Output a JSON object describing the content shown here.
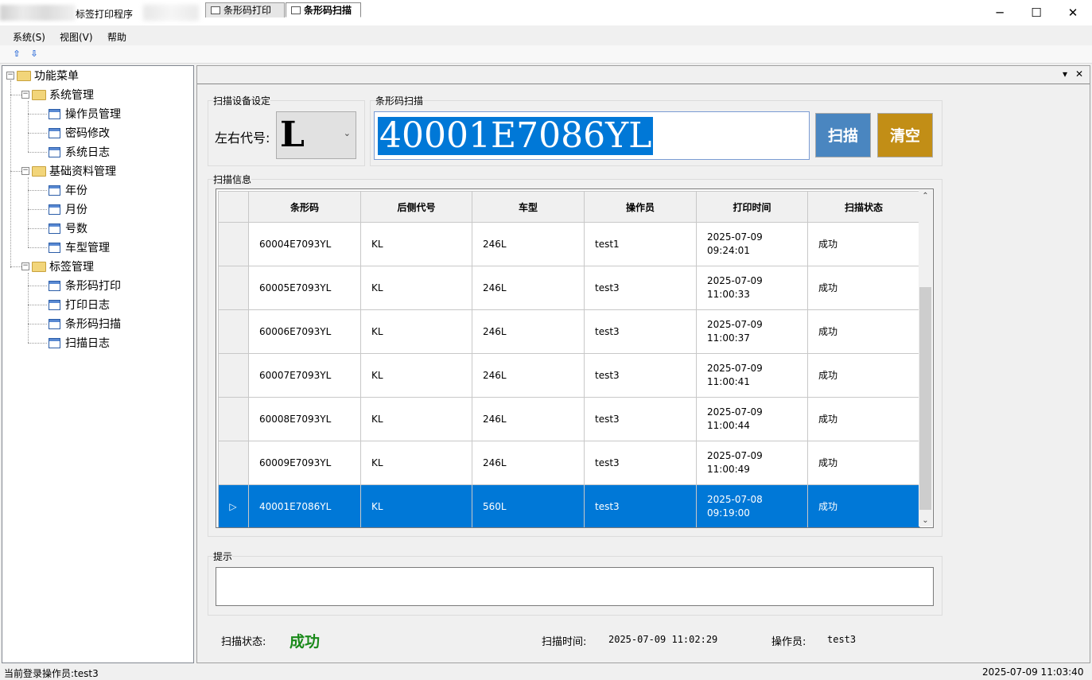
{
  "window": {
    "title": "标签打印程序",
    "minimize": "─",
    "maximize": "☐",
    "close": "✕"
  },
  "menu": [
    "系统(S)",
    "视图(V)",
    "帮助"
  ],
  "toolbar": {
    "up": "⇧",
    "down": "⇩"
  },
  "tree": {
    "root": "功能菜单",
    "groups": [
      {
        "label": "系统管理",
        "items": [
          "操作员管理",
          "密码修改",
          "系统日志"
        ]
      },
      {
        "label": "基础资料管理",
        "items": [
          "年份",
          "月份",
          "号数",
          "车型管理"
        ]
      },
      {
        "label": "标签管理",
        "items": [
          "条形码打印",
          "打印日志",
          "条形码扫描",
          "扫描日志"
        ]
      }
    ]
  },
  "tabs": [
    {
      "label": "条形码打印",
      "active": false
    },
    {
      "label": "条形码扫描",
      "active": true
    }
  ],
  "tab_controls": {
    "dropdown": "▾",
    "close": "✕"
  },
  "device_group": {
    "label": "扫描设备设定",
    "field_label": "左右代号:",
    "combo_value": "L",
    "combo_arrow": "⌄"
  },
  "scan_group": {
    "label": "条形码扫描",
    "input_value": "40001E7086YL",
    "scan_button": "扫描",
    "clear_button": "清空"
  },
  "info_group": {
    "label": "扫描信息",
    "columns": [
      "条形码",
      "后侧代号",
      "车型",
      "操作员",
      "打印时间",
      "扫描状态"
    ],
    "rows": [
      {
        "barcode": "60004E7093YL",
        "code": "KL",
        "model": "246L",
        "operator": "test1",
        "date": "2025-07-09",
        "time": "09:24:01",
        "status": "成功",
        "selected": false
      },
      {
        "barcode": "60005E7093YL",
        "code": "KL",
        "model": "246L",
        "operator": "test3",
        "date": "2025-07-09",
        "time": "11:00:33",
        "status": "成功",
        "selected": false
      },
      {
        "barcode": "60006E7093YL",
        "code": "KL",
        "model": "246L",
        "operator": "test3",
        "date": "2025-07-09",
        "time": "11:00:37",
        "status": "成功",
        "selected": false
      },
      {
        "barcode": "60007E7093YL",
        "code": "KL",
        "model": "246L",
        "operator": "test3",
        "date": "2025-07-09",
        "time": "11:00:41",
        "status": "成功",
        "selected": false
      },
      {
        "barcode": "60008E7093YL",
        "code": "KL",
        "model": "246L",
        "operator": "test3",
        "date": "2025-07-09",
        "time": "11:00:44",
        "status": "成功",
        "selected": false
      },
      {
        "barcode": "60009E7093YL",
        "code": "KL",
        "model": "246L",
        "operator": "test3",
        "date": "2025-07-09",
        "time": "11:00:49",
        "status": "成功",
        "selected": false
      },
      {
        "barcode": "40001E7086YL",
        "code": "KL",
        "model": "560L",
        "operator": "test3",
        "date": "2025-07-08",
        "time": "09:19:00",
        "status": "成功",
        "selected": true
      }
    ],
    "selected_marker": "▷",
    "scroll_up": "⌃",
    "scroll_down": "⌄"
  },
  "hint_group": {
    "label": "提示",
    "text": ""
  },
  "scan_summary": {
    "status_label": "扫描状态:",
    "status_value": "成功",
    "status_color": "#1a8a1a",
    "time_label": "扫描时间:",
    "time_value": "2025-07-09 11:02:29",
    "operator_label": "操作员:",
    "operator_value": "test3"
  },
  "statusbar": {
    "login": "当前登录操作员:test3",
    "clock": "2025-07-09 11:03:40"
  },
  "colors": {
    "scan_button": "#4a86c0",
    "clear_button": "#c28e16",
    "selection": "#0078d7"
  }
}
